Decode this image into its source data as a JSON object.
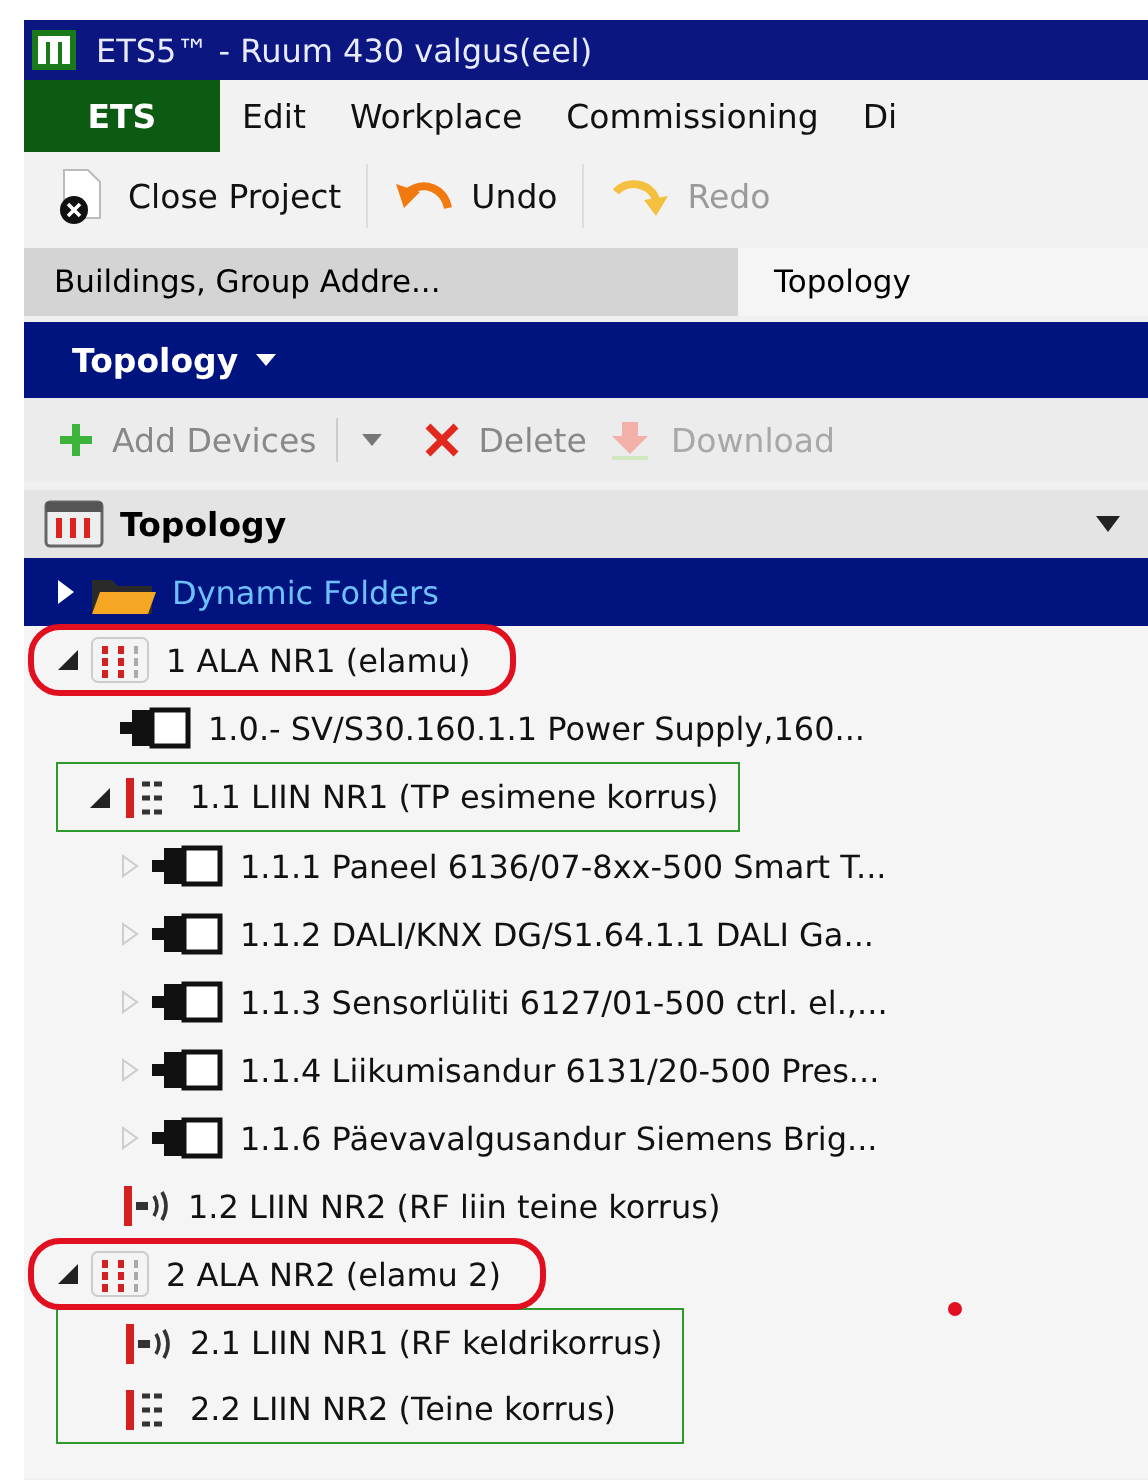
{
  "window": {
    "title": "ETS5™ - Ruum 430 valgus(eel)"
  },
  "menu": [
    {
      "label": "ETS",
      "selected": true
    },
    {
      "label": "Edit",
      "selected": false
    },
    {
      "label": "Workplace",
      "selected": false
    },
    {
      "label": "Commissioning",
      "selected": false
    },
    {
      "label": "Di",
      "selected": false
    }
  ],
  "toolbar": [
    {
      "kind": "close",
      "label": "Close Project",
      "disabled": false
    },
    {
      "kind": "undo",
      "label": "Undo",
      "disabled": false
    },
    {
      "kind": "redo",
      "label": "Redo",
      "disabled": true
    }
  ],
  "tabs": [
    {
      "label": "Buildings, Group Addre...",
      "selected": false
    },
    {
      "label": "Topology",
      "selected": true
    }
  ],
  "panel": {
    "title": "Topology",
    "actions": [
      {
        "kind": "add",
        "label": "Add Devices",
        "disabled": false,
        "dropdown": true
      },
      {
        "kind": "delete",
        "label": "Delete",
        "disabled": false,
        "dropdown": false
      },
      {
        "kind": "download",
        "label": "Download",
        "disabled": true,
        "dropdown": false
      }
    ],
    "tree_title": "Topology",
    "annotation_dot": true,
    "tree": [
      {
        "kind": "folder",
        "label": "Dynamic Folders",
        "expanded": false,
        "selected": true
      },
      {
        "kind": "area",
        "label": "1 ALA NR1 (elamu)",
        "expanded": true,
        "selected": false,
        "circled": true,
        "children": [
          {
            "kind": "device",
            "label": "1.0.- SV/S30.160.1.1 Power Supply,160...",
            "selected": false
          },
          {
            "kind": "line-tp",
            "label": "1.1 LIIN NR1 (TP esimene korrus)",
            "expanded": true,
            "selected": false,
            "boxed": true,
            "children": [
              {
                "kind": "device",
                "label": "1.1.1 Paneel 6136/07-8xx-500 Smart T...",
                "expanded": false,
                "selected": false
              },
              {
                "kind": "device",
                "label": "1.1.2 DALI/KNX DG/S1.64.1.1 DALI Ga...",
                "expanded": false,
                "selected": false
              },
              {
                "kind": "device",
                "label": "1.1.3 Sensorlüliti 6127/01-500 ctrl. el.,...",
                "expanded": false,
                "selected": false
              },
              {
                "kind": "device",
                "label": "1.1.4 Liikumisandur 6131/20-500 Pres...",
                "expanded": false,
                "selected": false
              },
              {
                "kind": "device",
                "label": "1.1.6 Päevavalgusandur Siemens Brig...",
                "expanded": false,
                "selected": false
              }
            ]
          },
          {
            "kind": "line-rf",
            "label": "1.2 LIIN NR2 (RF liin teine korrus)",
            "selected": false
          }
        ]
      },
      {
        "kind": "area",
        "label": "2  ALA NR2 (elamu 2)",
        "expanded": true,
        "selected": false,
        "circled": true,
        "children": [
          {
            "kind": "line-rf",
            "label": "2.1 LIIN NR1 (RF keldrikorrus)",
            "selected": false,
            "boxed": true
          },
          {
            "kind": "line-tp",
            "label": "2.2 LIIN NR2 (Teine korrus)",
            "selected": false,
            "boxed": true
          }
        ]
      }
    ]
  }
}
